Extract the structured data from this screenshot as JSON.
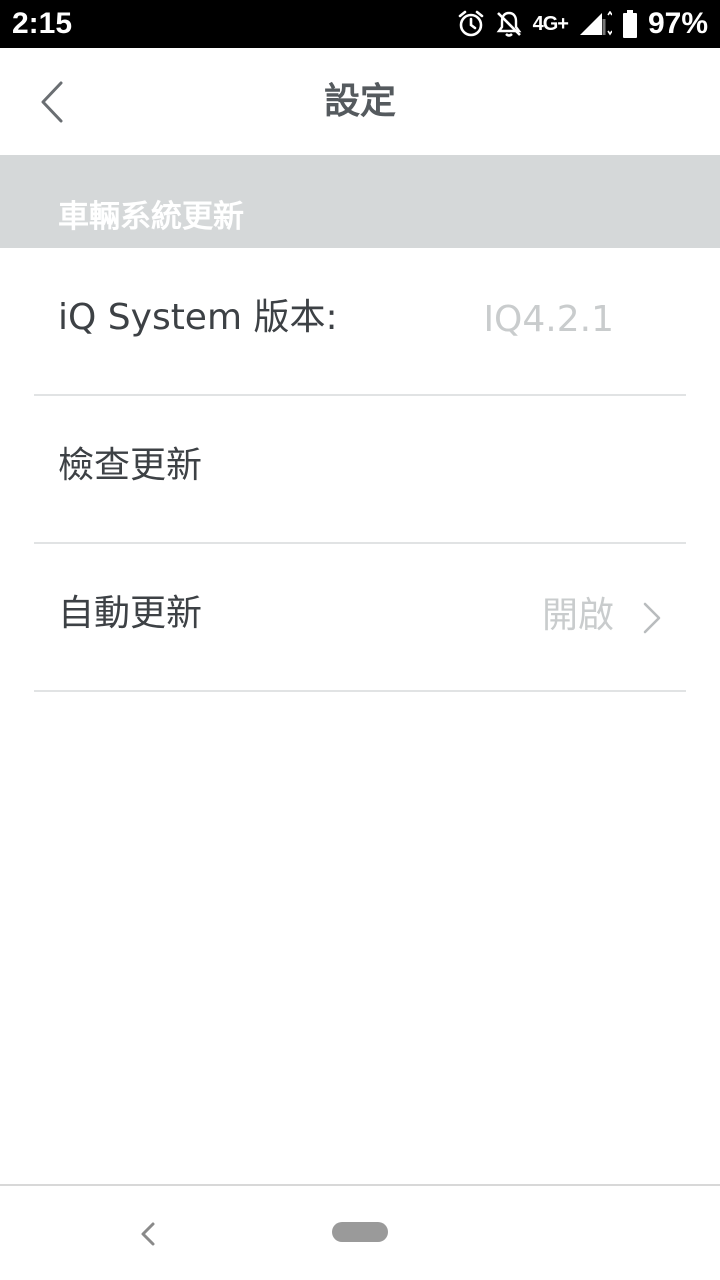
{
  "status_bar": {
    "time": "2:15",
    "network": "4G+",
    "battery": "97%",
    "icons": [
      "alarm-icon",
      "notifications-off-icon",
      "signal-icon",
      "battery-icon"
    ]
  },
  "header": {
    "title": "設定",
    "back_icon": "chevron-left-icon"
  },
  "section": {
    "title": "車輛系統更新"
  },
  "rows": [
    {
      "label": "iQ System 版本:",
      "value": "IQ4.2.1"
    },
    {
      "label": "檢查更新",
      "value": ""
    },
    {
      "label": "自動更新",
      "value": "開啟",
      "icon": "chevron-right-icon"
    }
  ],
  "nav_bar": {
    "back_icon": "nav-back-icon",
    "home_icon": "home-pill-icon"
  },
  "colors": {
    "section_background": "#d5d8d9",
    "title_text": "#555a5e",
    "label_text": "#3d4145",
    "value_text": "#c9cccd",
    "divider": "#e1e3e4"
  }
}
